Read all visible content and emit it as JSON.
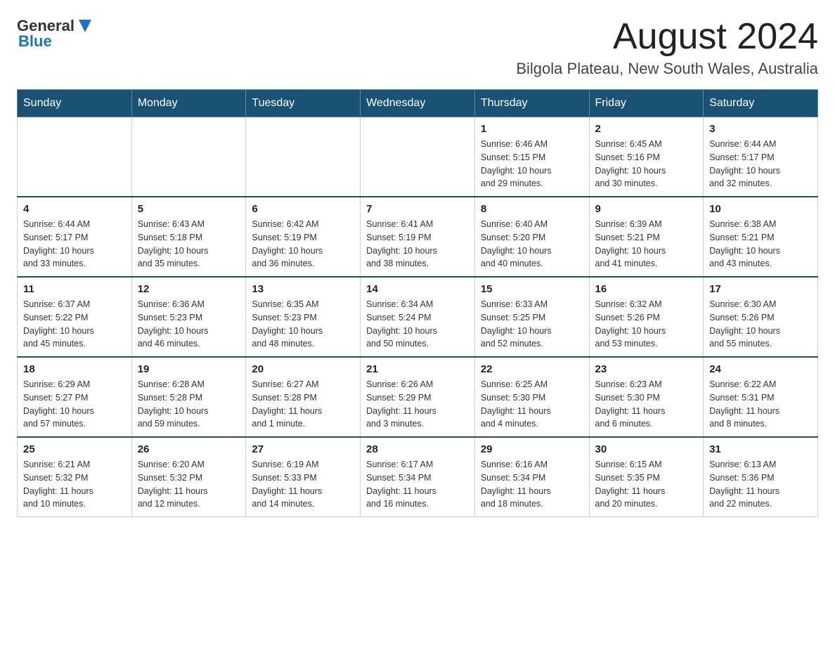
{
  "header": {
    "logo_general": "General",
    "logo_blue": "Blue",
    "month_title": "August 2024",
    "location": "Bilgola Plateau, New South Wales, Australia"
  },
  "weekdays": [
    "Sunday",
    "Monday",
    "Tuesday",
    "Wednesday",
    "Thursday",
    "Friday",
    "Saturday"
  ],
  "weeks": [
    [
      {
        "day": "",
        "info": ""
      },
      {
        "day": "",
        "info": ""
      },
      {
        "day": "",
        "info": ""
      },
      {
        "day": "",
        "info": ""
      },
      {
        "day": "1",
        "info": "Sunrise: 6:46 AM\nSunset: 5:15 PM\nDaylight: 10 hours\nand 29 minutes."
      },
      {
        "day": "2",
        "info": "Sunrise: 6:45 AM\nSunset: 5:16 PM\nDaylight: 10 hours\nand 30 minutes."
      },
      {
        "day": "3",
        "info": "Sunrise: 6:44 AM\nSunset: 5:17 PM\nDaylight: 10 hours\nand 32 minutes."
      }
    ],
    [
      {
        "day": "4",
        "info": "Sunrise: 6:44 AM\nSunset: 5:17 PM\nDaylight: 10 hours\nand 33 minutes."
      },
      {
        "day": "5",
        "info": "Sunrise: 6:43 AM\nSunset: 5:18 PM\nDaylight: 10 hours\nand 35 minutes."
      },
      {
        "day": "6",
        "info": "Sunrise: 6:42 AM\nSunset: 5:19 PM\nDaylight: 10 hours\nand 36 minutes."
      },
      {
        "day": "7",
        "info": "Sunrise: 6:41 AM\nSunset: 5:19 PM\nDaylight: 10 hours\nand 38 minutes."
      },
      {
        "day": "8",
        "info": "Sunrise: 6:40 AM\nSunset: 5:20 PM\nDaylight: 10 hours\nand 40 minutes."
      },
      {
        "day": "9",
        "info": "Sunrise: 6:39 AM\nSunset: 5:21 PM\nDaylight: 10 hours\nand 41 minutes."
      },
      {
        "day": "10",
        "info": "Sunrise: 6:38 AM\nSunset: 5:21 PM\nDaylight: 10 hours\nand 43 minutes."
      }
    ],
    [
      {
        "day": "11",
        "info": "Sunrise: 6:37 AM\nSunset: 5:22 PM\nDaylight: 10 hours\nand 45 minutes."
      },
      {
        "day": "12",
        "info": "Sunrise: 6:36 AM\nSunset: 5:23 PM\nDaylight: 10 hours\nand 46 minutes."
      },
      {
        "day": "13",
        "info": "Sunrise: 6:35 AM\nSunset: 5:23 PM\nDaylight: 10 hours\nand 48 minutes."
      },
      {
        "day": "14",
        "info": "Sunrise: 6:34 AM\nSunset: 5:24 PM\nDaylight: 10 hours\nand 50 minutes."
      },
      {
        "day": "15",
        "info": "Sunrise: 6:33 AM\nSunset: 5:25 PM\nDaylight: 10 hours\nand 52 minutes."
      },
      {
        "day": "16",
        "info": "Sunrise: 6:32 AM\nSunset: 5:26 PM\nDaylight: 10 hours\nand 53 minutes."
      },
      {
        "day": "17",
        "info": "Sunrise: 6:30 AM\nSunset: 5:26 PM\nDaylight: 10 hours\nand 55 minutes."
      }
    ],
    [
      {
        "day": "18",
        "info": "Sunrise: 6:29 AM\nSunset: 5:27 PM\nDaylight: 10 hours\nand 57 minutes."
      },
      {
        "day": "19",
        "info": "Sunrise: 6:28 AM\nSunset: 5:28 PM\nDaylight: 10 hours\nand 59 minutes."
      },
      {
        "day": "20",
        "info": "Sunrise: 6:27 AM\nSunset: 5:28 PM\nDaylight: 11 hours\nand 1 minute."
      },
      {
        "day": "21",
        "info": "Sunrise: 6:26 AM\nSunset: 5:29 PM\nDaylight: 11 hours\nand 3 minutes."
      },
      {
        "day": "22",
        "info": "Sunrise: 6:25 AM\nSunset: 5:30 PM\nDaylight: 11 hours\nand 4 minutes."
      },
      {
        "day": "23",
        "info": "Sunrise: 6:23 AM\nSunset: 5:30 PM\nDaylight: 11 hours\nand 6 minutes."
      },
      {
        "day": "24",
        "info": "Sunrise: 6:22 AM\nSunset: 5:31 PM\nDaylight: 11 hours\nand 8 minutes."
      }
    ],
    [
      {
        "day": "25",
        "info": "Sunrise: 6:21 AM\nSunset: 5:32 PM\nDaylight: 11 hours\nand 10 minutes."
      },
      {
        "day": "26",
        "info": "Sunrise: 6:20 AM\nSunset: 5:32 PM\nDaylight: 11 hours\nand 12 minutes."
      },
      {
        "day": "27",
        "info": "Sunrise: 6:19 AM\nSunset: 5:33 PM\nDaylight: 11 hours\nand 14 minutes."
      },
      {
        "day": "28",
        "info": "Sunrise: 6:17 AM\nSunset: 5:34 PM\nDaylight: 11 hours\nand 16 minutes."
      },
      {
        "day": "29",
        "info": "Sunrise: 6:16 AM\nSunset: 5:34 PM\nDaylight: 11 hours\nand 18 minutes."
      },
      {
        "day": "30",
        "info": "Sunrise: 6:15 AM\nSunset: 5:35 PM\nDaylight: 11 hours\nand 20 minutes."
      },
      {
        "day": "31",
        "info": "Sunrise: 6:13 AM\nSunset: 5:36 PM\nDaylight: 11 hours\nand 22 minutes."
      }
    ]
  ]
}
